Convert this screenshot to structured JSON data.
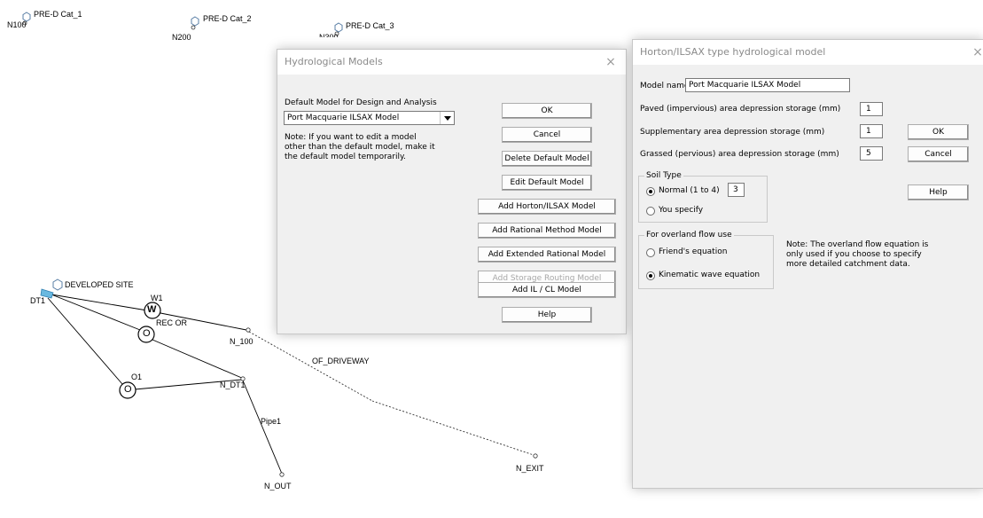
{
  "network": {
    "nodes": {
      "pre_cat_1": "PRE-D Cat_1",
      "n100_top": "N100",
      "pre_cat_2": "PRE-D Cat_2",
      "n200": "N200",
      "pre_cat_3": "PRE-D Cat_3",
      "n300": "N300",
      "developed_site": "DEVELOPED SITE",
      "dt1": "DT1",
      "w1": "W1",
      "w_symbol": "W",
      "rec_or": "REC OR",
      "orifice_symbol": "O",
      "o1": "O1",
      "n_100": "N_100",
      "n_dt1": "N_DT1",
      "of_driveway": "OF_DRIVEWAY",
      "pipe1": "Pipe1",
      "n_out": "N_OUT",
      "n_exit": "N_EXIT"
    }
  },
  "hydro_models": {
    "title": "Hydrological Models",
    "close": "×",
    "default_label": "Default Model for Design and Analysis",
    "default_value": "Port Macquarie ILSAX Model",
    "note_lines": [
      "Note:  If you want to edit a model",
      "other than the default model, make it",
      "the default model temporarily."
    ],
    "buttons": {
      "ok": "OK",
      "cancel": "Cancel",
      "delete": "Delete Default Model",
      "edit": "Edit Default Model",
      "add_horton": "Add Horton/ILSAX Model",
      "add_rational": "Add Rational Method Model",
      "add_ext_rational": "Add Extended Rational Model",
      "add_storage": "Add Storage Routing Model",
      "add_il_cl": "Add IL / CL Model",
      "help": "Help"
    }
  },
  "horton": {
    "title": "Horton/ILSAX type hydrological model",
    "close": "×",
    "model_name_label": "Model name",
    "model_name_value": "Port Macquarie ILSAX Model",
    "paved_label": "Paved (impervious) area depression storage (mm)",
    "paved_value": "1",
    "supp_label": "Supplementary area depression storage (mm)",
    "supp_value": "1",
    "grassed_label": "Grassed (pervious) area depression storage (mm)",
    "grassed_value": "5",
    "soil_group": "Soil Type",
    "soil_normal": "Normal (1 to 4)",
    "soil_normal_value": "3",
    "soil_specify": "You specify",
    "overland_group": "For overland flow use",
    "friends": "Friend's equation",
    "kinematic": "Kinematic wave equation",
    "note_lines": [
      "Note:  The overland flow equation is",
      "only used if you choose to specify",
      "more detailed catchment data."
    ],
    "buttons": {
      "ok": "OK",
      "cancel": "Cancel",
      "help": "Help"
    }
  }
}
